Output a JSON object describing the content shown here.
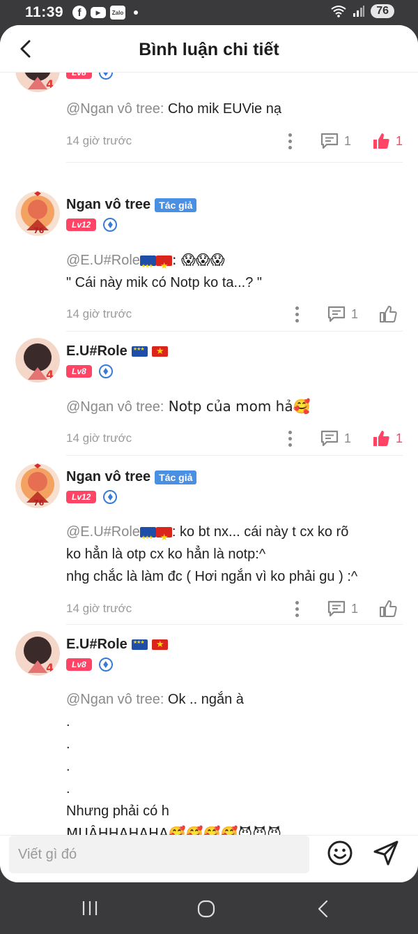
{
  "status_bar": {
    "time": "11:39",
    "app_icons": [
      "facebook-icon",
      "youtube-icon",
      "zalo-icon"
    ],
    "battery": "76"
  },
  "header": {
    "title": "Bình luận chi tiết"
  },
  "labels": {
    "author_badge": "Tác giả"
  },
  "comments": [
    {
      "author": "",
      "level": "Lv8",
      "mention": "@Ngan vô tree:",
      "lines": [
        " Cho mik EUVie nạ"
      ],
      "time": "14 giờ trước",
      "replies": "1",
      "likes": "1",
      "liked": true
    },
    {
      "author": "Ngan vô tree",
      "level": "Lv12",
      "is_author": true,
      "mention": "@E.U#Role",
      "lines": [
        ": 😱😱😱",
        "\" Cái này mik có Notp ko ta...? \""
      ],
      "time": "14 giờ trước",
      "replies": "1",
      "likes": "",
      "liked": false
    },
    {
      "author": "E.U#Role",
      "level": "Lv8",
      "mention": "@Ngan vô tree:",
      "lines": [
        " Notp của mom hả🥰"
      ],
      "time": "14 giờ trước",
      "replies": "1",
      "likes": "1",
      "liked": true
    },
    {
      "author": "Ngan vô tree",
      "level": "Lv12",
      "is_author": true,
      "mention": "@E.U#Role",
      "lines": [
        ": ko bt nx... cái này t cx ko rõ",
        "ko hẳn là otp cx ko hẳn là notp:^",
        "nhg chắc là làm đc ( Hơi ngắn vì ko phải gu ) :^"
      ],
      "time": "14 giờ trước",
      "replies": "1",
      "likes": "",
      "liked": false
    },
    {
      "author": "E.U#Role",
      "level": "Lv8",
      "mention": "@Ngan vô tree:",
      "lines": [
        " Ok .. ngắn à",
        ".",
        ".",
        ".",
        ".",
        "Nhưng phải có h",
        "MUÂHHAHAHA🥰🥰🥰🥰😈😈😈"
      ]
    }
  ],
  "input": {
    "placeholder": "Viết gì đó"
  },
  "colors": {
    "accent": "#ff4466",
    "author_badge": "#4a90e2",
    "rank_blue": "#3a7bd5",
    "mention_gray": "#8a8a8a"
  }
}
